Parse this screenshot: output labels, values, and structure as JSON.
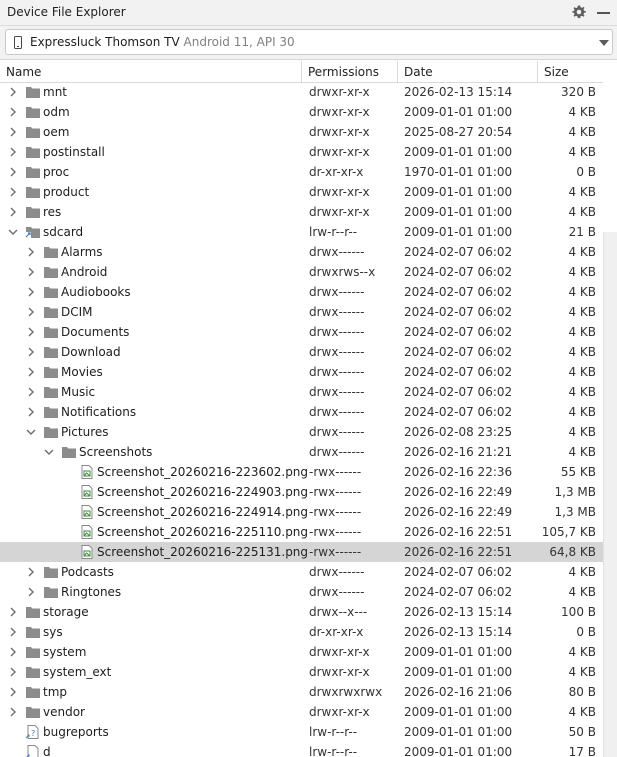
{
  "window": {
    "title": "Device File Explorer",
    "settings_icon": "gear-icon",
    "minimize_icon": "minimize-icon"
  },
  "device": {
    "name": "Expressluck Thomson TV",
    "info": "Android 11, API 30"
  },
  "columns": {
    "name": "Name",
    "permissions": "Permissions",
    "date": "Date",
    "size": "Size"
  },
  "colors": {
    "folder": "#8c8c8c",
    "file_accent": "#3c8c3c",
    "selected_row": "#d5d5d5",
    "link_badge": "#3b7bbf"
  },
  "rows": [
    {
      "name": "mnt",
      "perm": "drwxr-xr-x",
      "date": "2026-02-13 15:14",
      "size": "320 B",
      "depth": 0,
      "type": "folder",
      "state": "collapsed"
    },
    {
      "name": "odm",
      "perm": "drwxr-xr-x",
      "date": "2009-01-01 01:00",
      "size": "4 KB",
      "depth": 0,
      "type": "folder",
      "state": "collapsed"
    },
    {
      "name": "oem",
      "perm": "drwxr-xr-x",
      "date": "2025-08-27 20:54",
      "size": "4 KB",
      "depth": 0,
      "type": "folder",
      "state": "collapsed"
    },
    {
      "name": "postinstall",
      "perm": "drwxr-xr-x",
      "date": "2009-01-01 01:00",
      "size": "4 KB",
      "depth": 0,
      "type": "folder",
      "state": "collapsed"
    },
    {
      "name": "proc",
      "perm": "dr-xr-xr-x",
      "date": "1970-01-01 01:00",
      "size": "0 B",
      "depth": 0,
      "type": "folder",
      "state": "collapsed"
    },
    {
      "name": "product",
      "perm": "drwxr-xr-x",
      "date": "2009-01-01 01:00",
      "size": "4 KB",
      "depth": 0,
      "type": "folder",
      "state": "collapsed"
    },
    {
      "name": "res",
      "perm": "drwxr-xr-x",
      "date": "2009-01-01 01:00",
      "size": "4 KB",
      "depth": 0,
      "type": "folder",
      "state": "collapsed"
    },
    {
      "name": "sdcard",
      "perm": "lrw-r--r--",
      "date": "2009-01-01 01:00",
      "size": "21 B",
      "depth": 0,
      "type": "link-folder",
      "state": "expanded"
    },
    {
      "name": "Alarms",
      "perm": "drwx------",
      "date": "2024-02-07 06:02",
      "size": "4 KB",
      "depth": 1,
      "type": "folder",
      "state": "collapsed"
    },
    {
      "name": "Android",
      "perm": "drwxrws--x",
      "date": "2024-02-07 06:02",
      "size": "4 KB",
      "depth": 1,
      "type": "folder",
      "state": "collapsed"
    },
    {
      "name": "Audiobooks",
      "perm": "drwx------",
      "date": "2024-02-07 06:02",
      "size": "4 KB",
      "depth": 1,
      "type": "folder",
      "state": "collapsed"
    },
    {
      "name": "DCIM",
      "perm": "drwx------",
      "date": "2024-02-07 06:02",
      "size": "4 KB",
      "depth": 1,
      "type": "folder",
      "state": "collapsed"
    },
    {
      "name": "Documents",
      "perm": "drwx------",
      "date": "2024-02-07 06:02",
      "size": "4 KB",
      "depth": 1,
      "type": "folder",
      "state": "collapsed"
    },
    {
      "name": "Download",
      "perm": "drwx------",
      "date": "2024-02-07 06:02",
      "size": "4 KB",
      "depth": 1,
      "type": "folder",
      "state": "collapsed"
    },
    {
      "name": "Movies",
      "perm": "drwx------",
      "date": "2024-02-07 06:02",
      "size": "4 KB",
      "depth": 1,
      "type": "folder",
      "state": "collapsed"
    },
    {
      "name": "Music",
      "perm": "drwx------",
      "date": "2024-02-07 06:02",
      "size": "4 KB",
      "depth": 1,
      "type": "folder",
      "state": "collapsed"
    },
    {
      "name": "Notifications",
      "perm": "drwx------",
      "date": "2024-02-07 06:02",
      "size": "4 KB",
      "depth": 1,
      "type": "folder",
      "state": "collapsed"
    },
    {
      "name": "Pictures",
      "perm": "drwx------",
      "date": "2026-02-08 23:25",
      "size": "4 KB",
      "depth": 1,
      "type": "folder",
      "state": "expanded"
    },
    {
      "name": "Screenshots",
      "perm": "drwx------",
      "date": "2026-02-16 21:21",
      "size": "4 KB",
      "depth": 2,
      "type": "folder",
      "state": "expanded"
    },
    {
      "name": "Screenshot_20260216-223602.png",
      "perm": "-rwx------",
      "date": "2026-02-16 22:36",
      "size": "55 KB",
      "depth": 3,
      "type": "file",
      "state": "none"
    },
    {
      "name": "Screenshot_20260216-224903.png",
      "perm": "-rwx------",
      "date": "2026-02-16 22:49",
      "size": "1,3 MB",
      "depth": 3,
      "type": "file",
      "state": "none"
    },
    {
      "name": "Screenshot_20260216-224914.png",
      "perm": "-rwx------",
      "date": "2026-02-16 22:49",
      "size": "1,3 MB",
      "depth": 3,
      "type": "file",
      "state": "none"
    },
    {
      "name": "Screenshot_20260216-225110.png",
      "perm": "-rwx------",
      "date": "2026-02-16 22:51",
      "size": "105,7 KB",
      "depth": 3,
      "type": "file",
      "state": "none"
    },
    {
      "name": "Screenshot_20260216-225131.png",
      "perm": "-rwx------",
      "date": "2026-02-16 22:51",
      "size": "64,8 KB",
      "depth": 3,
      "type": "file",
      "state": "none",
      "selected": true
    },
    {
      "name": "Podcasts",
      "perm": "drwx------",
      "date": "2024-02-07 06:02",
      "size": "4 KB",
      "depth": 1,
      "type": "folder",
      "state": "collapsed"
    },
    {
      "name": "Ringtones",
      "perm": "drwx------",
      "date": "2024-02-07 06:02",
      "size": "4 KB",
      "depth": 1,
      "type": "folder",
      "state": "collapsed"
    },
    {
      "name": "storage",
      "perm": "drwx--x---",
      "date": "2026-02-13 15:14",
      "size": "100 B",
      "depth": 0,
      "type": "folder",
      "state": "collapsed"
    },
    {
      "name": "sys",
      "perm": "dr-xr-xr-x",
      "date": "2026-02-13 15:14",
      "size": "0 B",
      "depth": 0,
      "type": "folder",
      "state": "collapsed"
    },
    {
      "name": "system",
      "perm": "drwxr-xr-x",
      "date": "2009-01-01 01:00",
      "size": "4 KB",
      "depth": 0,
      "type": "folder",
      "state": "collapsed"
    },
    {
      "name": "system_ext",
      "perm": "drwxr-xr-x",
      "date": "2009-01-01 01:00",
      "size": "4 KB",
      "depth": 0,
      "type": "folder",
      "state": "collapsed"
    },
    {
      "name": "tmp",
      "perm": "drwxrwxrwx",
      "date": "2026-02-16 21:06",
      "size": "80 B",
      "depth": 0,
      "type": "folder",
      "state": "collapsed"
    },
    {
      "name": "vendor",
      "perm": "drwxr-xr-x",
      "date": "2009-01-01 01:00",
      "size": "4 KB",
      "depth": 0,
      "type": "folder",
      "state": "collapsed"
    },
    {
      "name": "bugreports",
      "perm": "lrw-r--r--",
      "date": "2009-01-01 01:00",
      "size": "50 B",
      "depth": 0,
      "type": "link-unknown",
      "state": "none"
    },
    {
      "name": "d",
      "perm": "lrw-r--r--",
      "date": "2009-01-01 01:00",
      "size": "17 B",
      "depth": 0,
      "type": "link-file",
      "state": "none"
    }
  ]
}
